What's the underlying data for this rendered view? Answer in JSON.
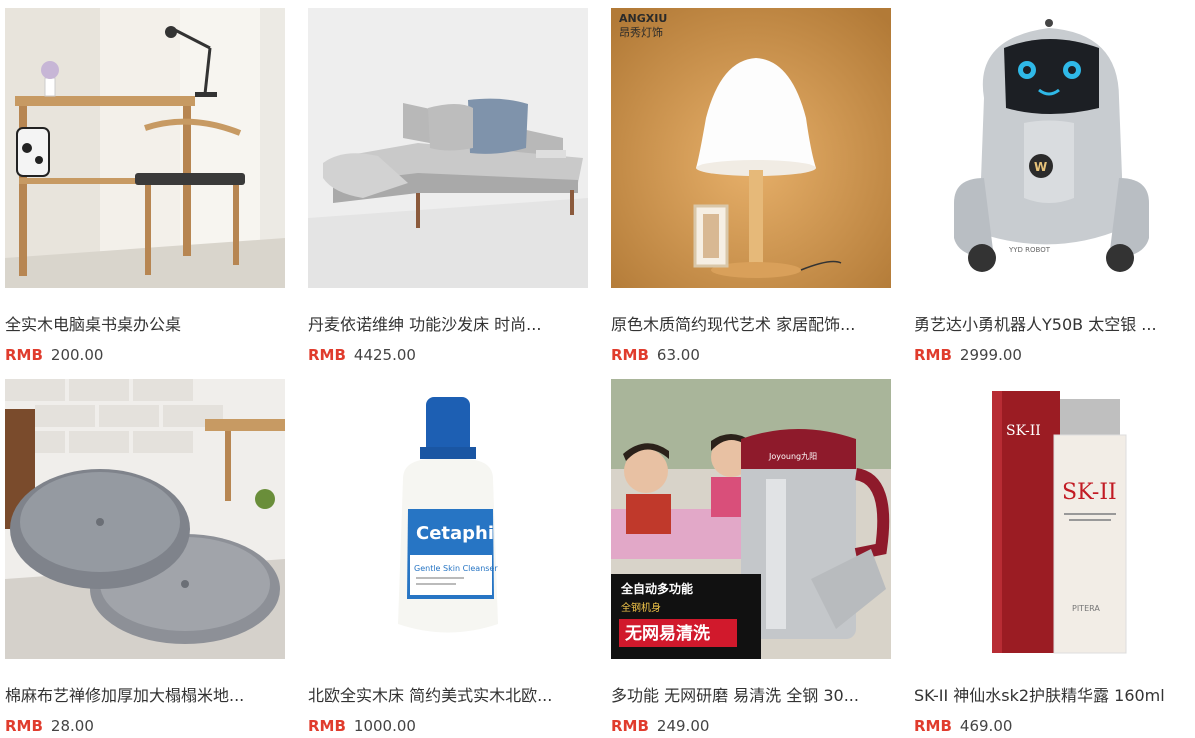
{
  "currency_label": "RMB",
  "accent_color": "#e03c2d",
  "products": [
    {
      "title": "全实木电脑桌书桌办公桌",
      "price": "200.00",
      "image_icon": "desk-chair-image"
    },
    {
      "title": "丹麦依诺维绅 功能沙发床 时尚...",
      "price": "4425.00",
      "image_icon": "sofa-bed-image"
    },
    {
      "title": "原色木质简约现代艺术 家居配饰...",
      "price": "63.00",
      "image_icon": "table-lamp-image",
      "image_brand": "ANGXIU",
      "image_brand_cn": "昂秀灯饰"
    },
    {
      "title": "勇艺达小勇机器人Y50B 太空银 ...",
      "price": "2999.00",
      "image_icon": "robot-image",
      "image_brand": "YYD ROBOT"
    },
    {
      "title": "棉麻布艺禅修加厚加大榻榻米地...",
      "price": "28.00",
      "image_icon": "floor-cushion-image"
    },
    {
      "title": "北欧全实木床 简约美式实木北欧...",
      "price": "1000.00",
      "image_icon": "cleanser-bottle-image",
      "image_brand": "Cetaphil",
      "image_sub": "Gentle Skin Cleanser"
    },
    {
      "title": "多功能 无网研磨 易清洗 全钢 30...",
      "price": "249.00",
      "image_icon": "soymilk-maker-image",
      "image_brand": "Joyoung九阳",
      "image_banner1": "全自动多功能",
      "image_banner2": "全钢机身",
      "image_banner3": "无网易清洗"
    },
    {
      "title": "SK-II 神仙水sk2护肤精华露 160ml",
      "price": "469.00",
      "image_icon": "essence-bottle-image",
      "image_brand": "SK-II",
      "image_sub": "PITERA"
    }
  ]
}
